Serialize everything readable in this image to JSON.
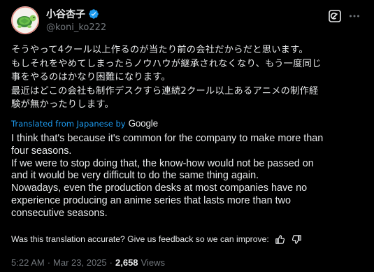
{
  "author": {
    "display_name": "小谷杏子",
    "handle": "@koni_ko222",
    "avatar_icon": "turtle-avatar-icon",
    "verified_icon": "verified-badge-icon"
  },
  "actions": {
    "grok_icon": "grok-icon",
    "more_icon": "more-horizontal-icon"
  },
  "tweet": {
    "original_text": "そうやって4クール以上作るのが当たり前の会社だからだと思います。\nもしそれをやめてしまったらノウハウが継承されなくなり、もう一度同じ\n事をやるのはかなり困難になります。\n最近はどこの会社も制作デスクすら連続2クール以上あるアニメの制作経\n験が無かったりします。",
    "translated_from_label": "Translated from Japanese by",
    "translation_provider": "Google",
    "translated_text": "I think that's because it's common for the company to make more than\nfour seasons.\nIf we were to stop doing that, the know-how would not be passed on\nand it would be very difficult to do the same thing again.\nNowadays, even the production desks at most companies have no\nexperience producing an anime series that lasts more than two\nconsecutive seasons."
  },
  "feedback": {
    "prompt": "Was this translation accurate? Give us feedback so we can improve:",
    "thumbs_up_icon": "thumbs-up-icon",
    "thumbs_down_icon": "thumbs-down-icon"
  },
  "meta": {
    "time": "5:22 AM",
    "separator": "·",
    "date": "Mar 23, 2025",
    "views_count": "2,658",
    "views_label": "Views"
  },
  "colors": {
    "background": "#000000",
    "text_primary": "#e7e9ea",
    "text_secondary": "#71767b",
    "accent_blue": "#1d9bf0"
  }
}
